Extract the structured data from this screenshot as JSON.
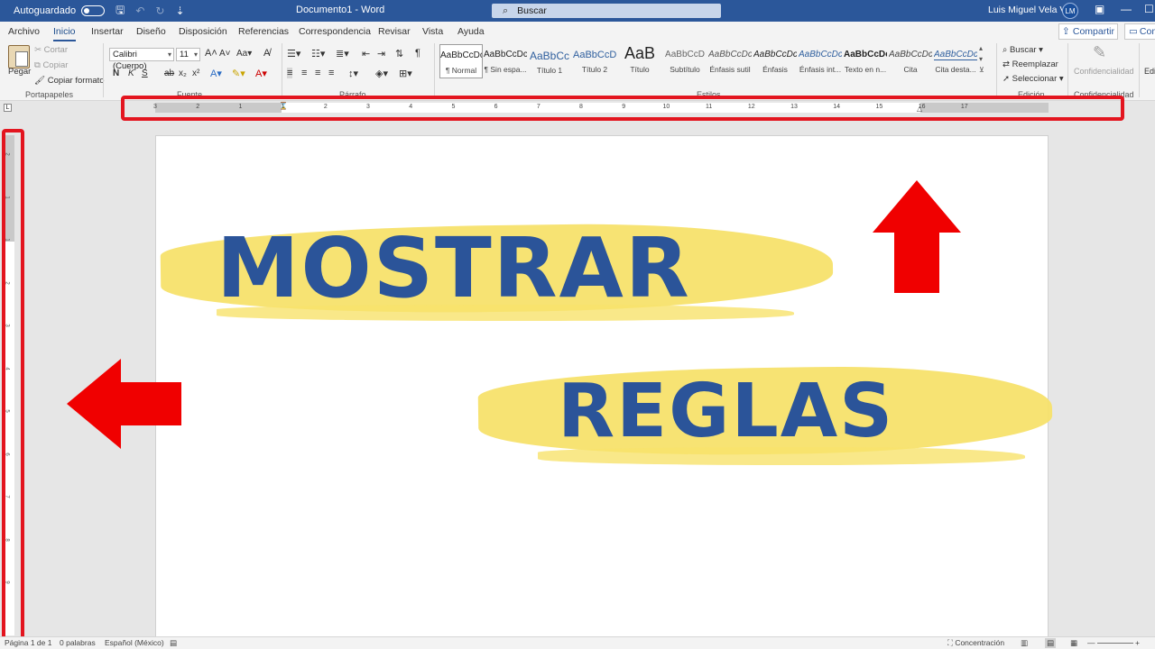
{
  "titlebar": {
    "autosave_label": "Autoguardado",
    "doc_title": "Documento1  -  Word",
    "search_placeholder": "Buscar",
    "user_name": "Luis Miguel Vela Vela",
    "user_initials": "LM"
  },
  "tabs": [
    "Archivo",
    "Inicio",
    "Insertar",
    "Diseño",
    "Disposición",
    "Referencias",
    "Correspondencia",
    "Revisar",
    "Vista",
    "Ayuda"
  ],
  "active_tab": "Inicio",
  "share_label": "Compartir",
  "comments_label": "Com",
  "clipboard": {
    "paste": "Pegar",
    "cut": "Cortar",
    "copy": "Copiar",
    "format_painter": "Copiar formato",
    "group": "Portapapeles"
  },
  "font": {
    "name": "Calibri (Cuerpo)",
    "size": "11",
    "group": "Fuente",
    "bold": "N",
    "italic": "K",
    "underline": "S"
  },
  "paragraph": {
    "group": "Párrafo"
  },
  "styles": {
    "group": "Estilos",
    "items": [
      {
        "sample": "AaBbCcDc",
        "name": "¶ Normal"
      },
      {
        "sample": "AaBbCcDc",
        "name": "¶ Sin espa..."
      },
      {
        "sample": "AaBbCc",
        "name": "Título 1"
      },
      {
        "sample": "AaBbCcD",
        "name": "Título 2"
      },
      {
        "sample": "AaB",
        "name": "Título"
      },
      {
        "sample": "AaBbCcD",
        "name": "Subtítulo"
      },
      {
        "sample": "AaBbCcDc",
        "name": "Énfasis sutil"
      },
      {
        "sample": "AaBbCcDc",
        "name": "Énfasis"
      },
      {
        "sample": "AaBbCcDc",
        "name": "Énfasis int..."
      },
      {
        "sample": "AaBbCcDc",
        "name": "Texto en n..."
      },
      {
        "sample": "AaBbCcDc",
        "name": "Cita"
      },
      {
        "sample": "AaBbCcDc",
        "name": "Cita desta..."
      }
    ]
  },
  "editing": {
    "find": "Buscar",
    "replace": "Reemplazar",
    "select": "Seleccionar",
    "group": "Edición"
  },
  "sensitivity": {
    "label": "Confidencialidad",
    "group": "Confidencialidad"
  },
  "editor_label": "Edi",
  "ruler_numbers": [
    "3",
    "2",
    "1",
    "1",
    "2",
    "3",
    "4",
    "5",
    "6",
    "7",
    "8",
    "9",
    "10",
    "11",
    "12",
    "13",
    "14",
    "15",
    "16",
    "17"
  ],
  "vruler_numbers": [
    "2",
    "1",
    "1",
    "2",
    "3",
    "4",
    "5",
    "6",
    "7",
    "8",
    "9"
  ],
  "overlay": {
    "word1": "MOSTRAR",
    "word2": "REGLAS"
  },
  "statusbar": {
    "page": "Página 1 de 1",
    "words": "0 palabras",
    "language": "Español (México)",
    "focus": "Concentración"
  },
  "colors": {
    "word_blue": "#2b579a",
    "highlight_red": "#e3151f",
    "brush_yellow": "#f7e26b",
    "text_blue": "#2b5499"
  }
}
